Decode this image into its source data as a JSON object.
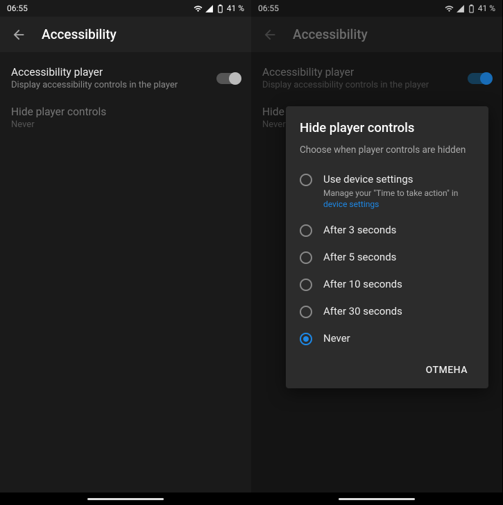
{
  "status": {
    "time": "06:55",
    "battery": "41 %"
  },
  "header": {
    "title": "Accessibility"
  },
  "settings": {
    "player_title": "Accessibility player",
    "player_sub": "Display accessibility controls in the player",
    "hide_title": "Hide player controls",
    "hide_value": "Never"
  },
  "dialog": {
    "title": "Hide player controls",
    "sub": "Choose when player controls are hidden",
    "options": {
      "device": "Use device settings",
      "device_desc_a": "Manage your \"Time to take action\" in ",
      "device_desc_link": "device settings",
      "s3": "After 3 seconds",
      "s5": "After 5 seconds",
      "s10": "After 10 seconds",
      "s30": "After 30 seconds",
      "never": "Never"
    },
    "cancel": "ОТМЕНА"
  }
}
